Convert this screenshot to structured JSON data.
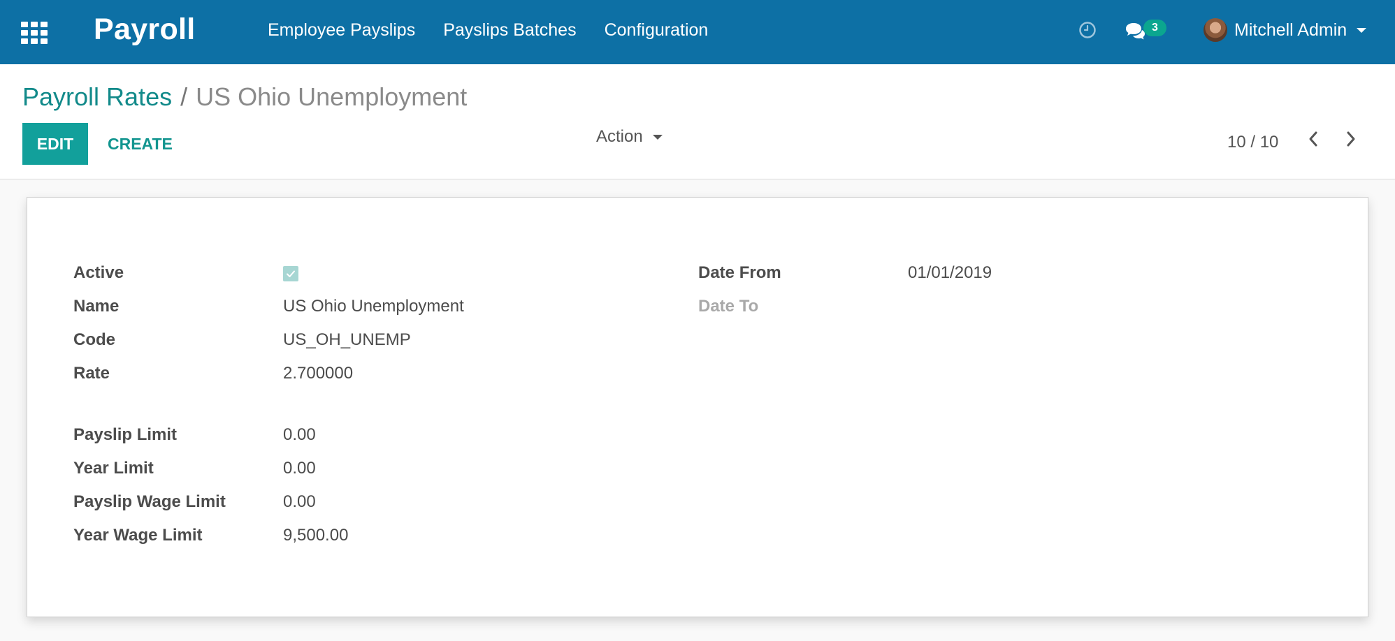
{
  "navbar": {
    "app_title": "Payroll",
    "menu": [
      "Employee Payslips",
      "Payslips Batches",
      "Configuration"
    ],
    "chat_count": "3",
    "user_name": "Mitchell Admin",
    "icons": {
      "apps": "apps-grid-icon",
      "activity": "clock-icon",
      "messages": "chat-icon"
    }
  },
  "breadcrumb": {
    "parent": "Payroll Rates",
    "separator": "/",
    "current": "US Ohio Unemployment"
  },
  "toolbar": {
    "edit_label": "EDIT",
    "create_label": "CREATE",
    "action_label": "Action",
    "pager": "10 / 10"
  },
  "form": {
    "active": {
      "label": "Active",
      "checked": true
    },
    "name": {
      "label": "Name",
      "value": "US Ohio Unemployment"
    },
    "code": {
      "label": "Code",
      "value": "US_OH_UNEMP"
    },
    "rate": {
      "label": "Rate",
      "value": "2.700000"
    },
    "payslip_limit": {
      "label": "Payslip Limit",
      "value": "0.00"
    },
    "year_limit": {
      "label": "Year Limit",
      "value": "0.00"
    },
    "payslip_wage_limit": {
      "label": "Payslip Wage Limit",
      "value": "0.00"
    },
    "year_wage_limit": {
      "label": "Year Wage Limit",
      "value": "9,500.00"
    },
    "date_from": {
      "label": "Date From",
      "value": "01/01/2019"
    },
    "date_to": {
      "label": "Date To",
      "value": ""
    }
  },
  "colors": {
    "navbar": "#0d70a5",
    "primary_button": "#12a09b",
    "link": "#128a8a",
    "badge": "#0ba68f"
  }
}
